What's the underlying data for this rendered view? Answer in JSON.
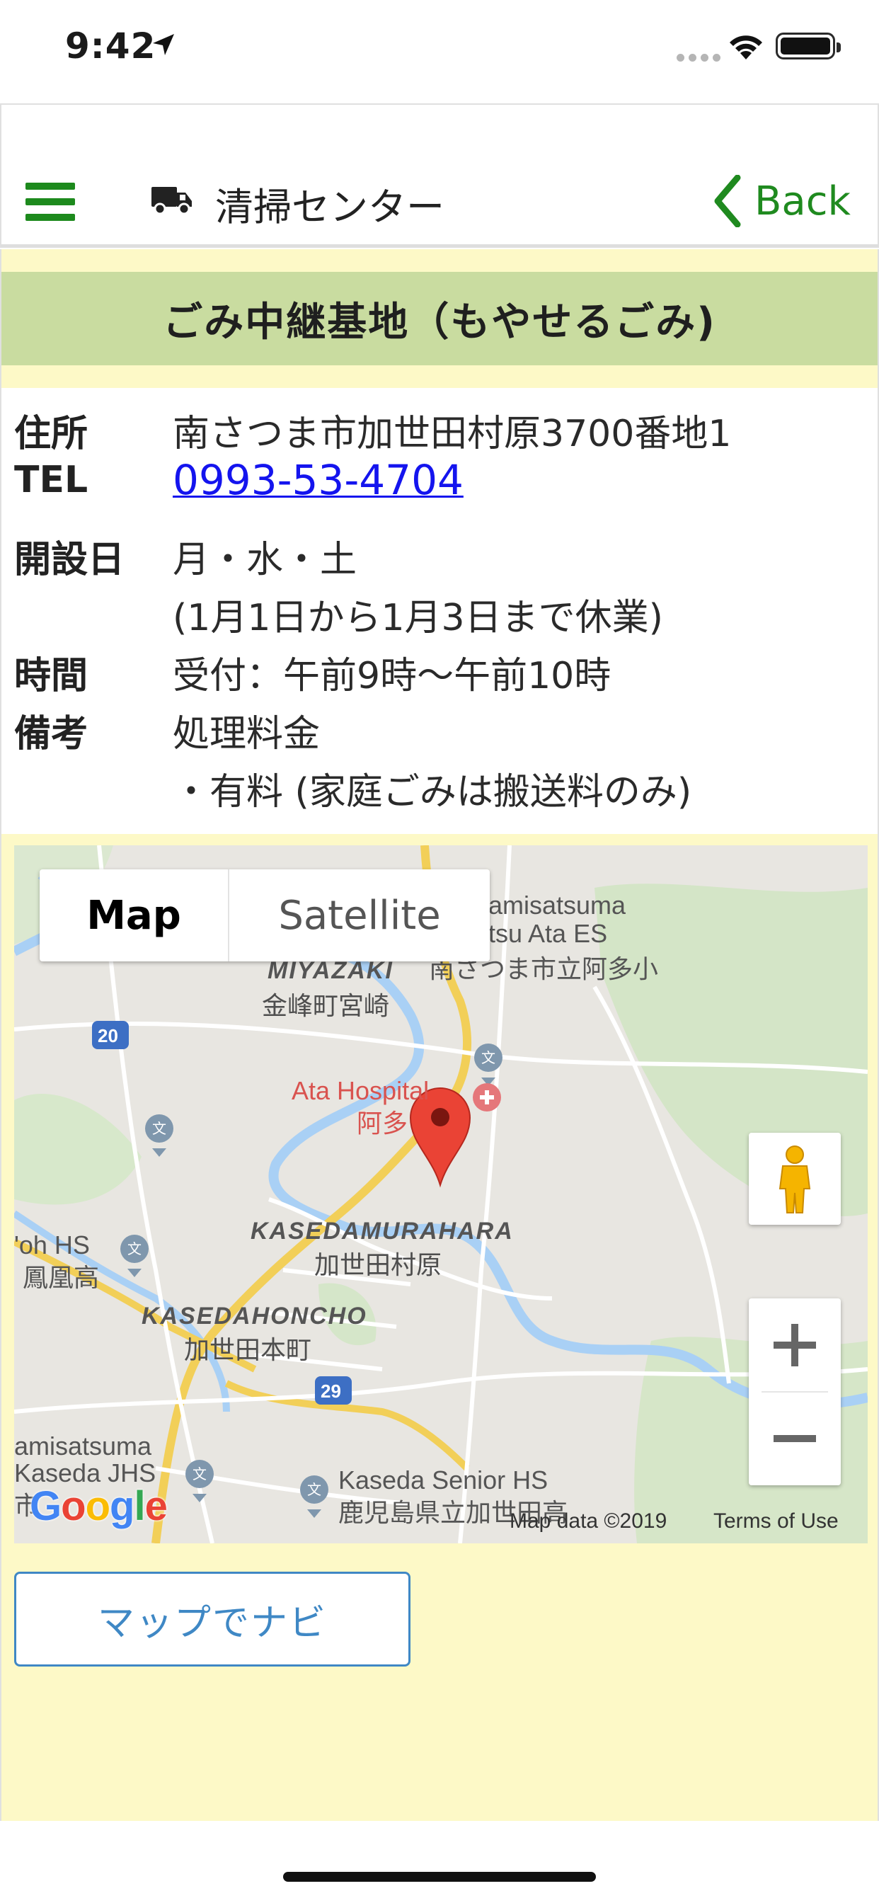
{
  "status_bar": {
    "time": "9:42"
  },
  "navbar": {
    "title": "清掃センター",
    "back_label": "Back",
    "accent_color": "#1f8a1f"
  },
  "facility": {
    "name": "ごみ中継基地（もやせるごみ)",
    "address_label": "住所",
    "address": "南さつま市加世田村原3700番地1",
    "tel_label": "TEL",
    "tel": "0993-53-4704",
    "open_days_label": "開設日",
    "open_days": "月・水・土",
    "open_days_note": "(1月1日から1月3日まで休業)",
    "hours_label": "時間",
    "hours": "受付：午前9時～午前10時",
    "remarks_label": "備考",
    "remarks": "処理料金",
    "remarks_detail": "・有料 (家庭ごみは搬送料のみ)"
  },
  "map": {
    "type_options": [
      "Map",
      "Satellite"
    ],
    "selected_type": "Map",
    "labels": {
      "miyazaki_en": "MIYAZAKI",
      "miyazaki_jp": "金峰町宮崎",
      "hospital_en": "Ata Hospital",
      "hospital_jp": "阿多",
      "murahara_en": "KASEDAMURAHARA",
      "murahara_jp": "加世田村原",
      "honcho_en": "KASEDAHONCHO",
      "honcho_jp": "加世田本町",
      "ata_es_1": "amisatsuma",
      "ata_es_2": "tsu Ata ES",
      "ata_es_jp": "南さつま市立阿多小",
      "oh_hs": "'oh HS",
      "oh_hs_jp": "鳳凰高",
      "jhs_1": "amisatsuma",
      "jhs_2": "Kaseda JHS",
      "jhs_3": "市",
      "senior_hs": "Kaseda Senior HS",
      "senior_hs_jp": "鹿児島県立加世田高",
      "route_20": "20",
      "route_29": "29"
    },
    "attribution": "Map data ©2019",
    "terms": "Terms of Use",
    "logo": "Google"
  },
  "actions": {
    "navigate_label": "マップでナビ"
  }
}
